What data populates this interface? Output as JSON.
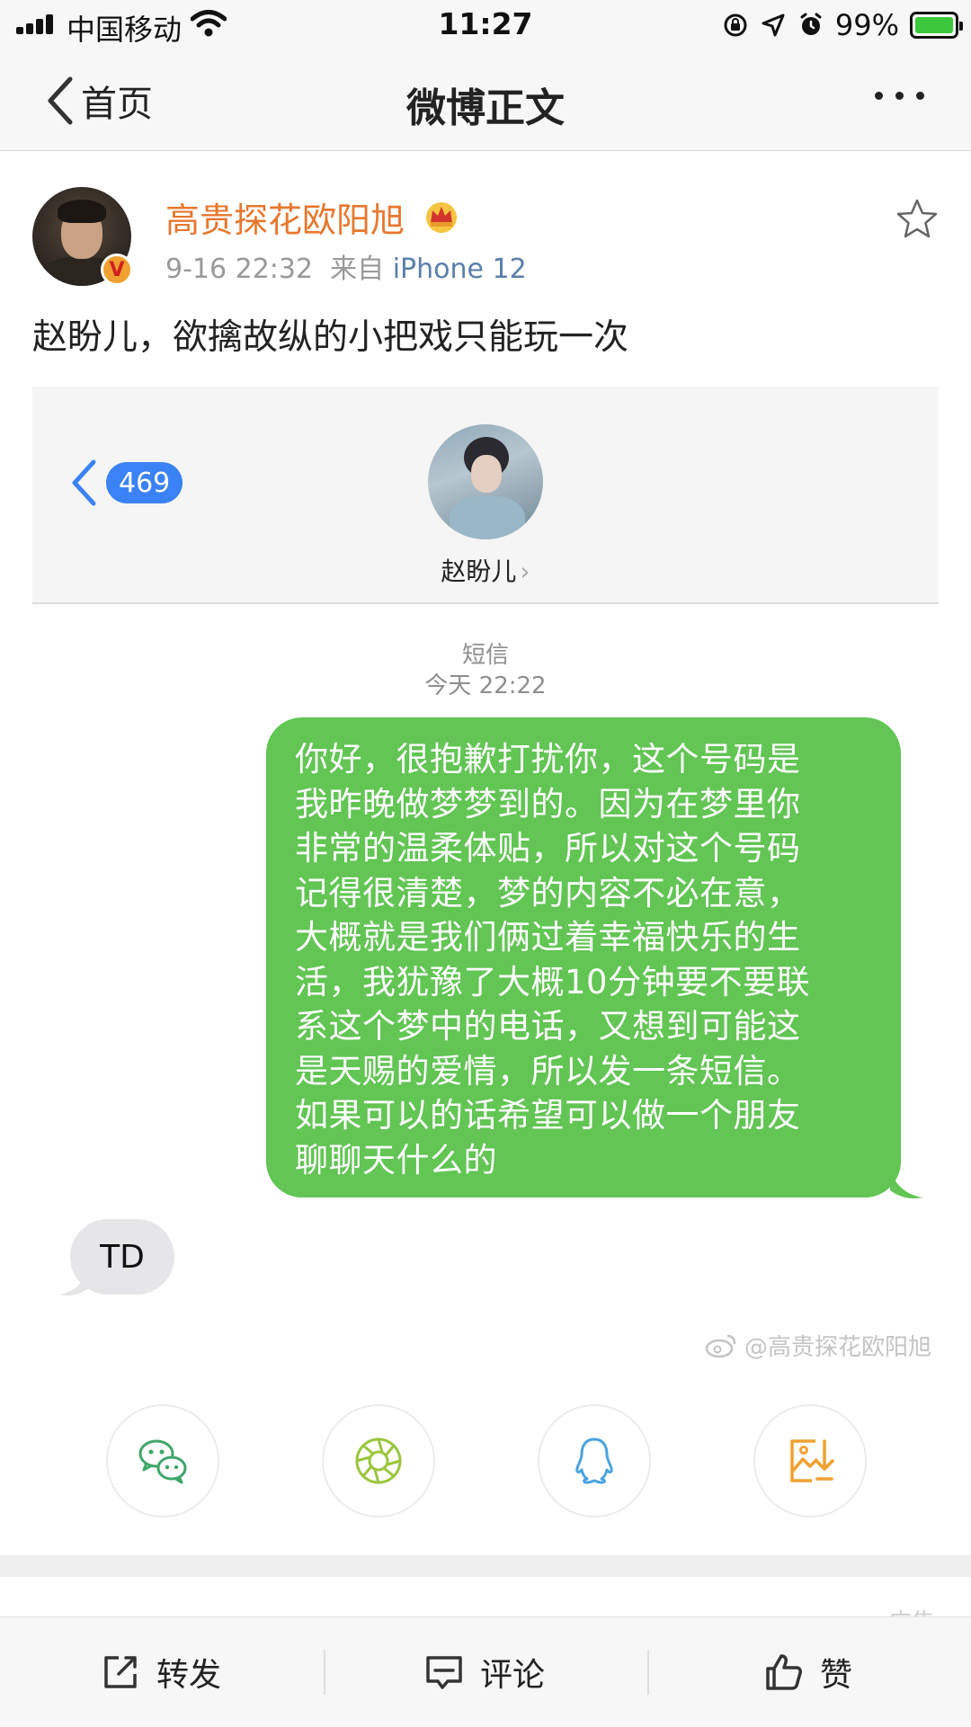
{
  "status_bar": {
    "carrier": "中国移动",
    "time": "11:27",
    "battery": "99%"
  },
  "nav": {
    "back_label": "首页",
    "title": "微博正文"
  },
  "post": {
    "username": "高贵探花欧阳旭",
    "verified_mark": "V",
    "datetime": "9-16 22:32",
    "source_prefix": "来自",
    "source": "iPhone 12",
    "text": "赵盼儿，欲擒故纵的小把戏只能玩一次"
  },
  "screenshot": {
    "unread_count": "469",
    "contact_name": "赵盼儿",
    "message_kind": "短信",
    "message_time": "今天 22:22",
    "outgoing_lines": [
      "你好，很抱歉打扰你，这个号码是",
      "我昨晚做梦梦到的。因为在梦里你",
      "非常的温柔体贴，所以对这个号码",
      "记得很清楚，梦的内容不必在意，",
      "大概就是我们俩过着幸福快乐的生",
      "活，我犹豫了大概10分钟要不要联",
      "系这个梦中的电话，又想到可能这",
      "是天赐的爱情，所以发一条短信。",
      "如果可以的话希望可以做一个朋友",
      "聊聊天什么的"
    ],
    "incoming": "TD",
    "watermark": "@高贵探花欧阳旭"
  },
  "share": [
    "wechat-icon",
    "moments-icon",
    "qq-icon",
    "save-image-icon"
  ],
  "ad_label": "广告",
  "toolbar": {
    "repost": "转发",
    "comment": "评论",
    "like": "赞"
  },
  "colors": {
    "username": "#e8772e",
    "bubble_out": "#62c554",
    "bubble_in": "#e6e6e8",
    "badge": "#3b82f6",
    "source_link": "#5b7faa"
  }
}
